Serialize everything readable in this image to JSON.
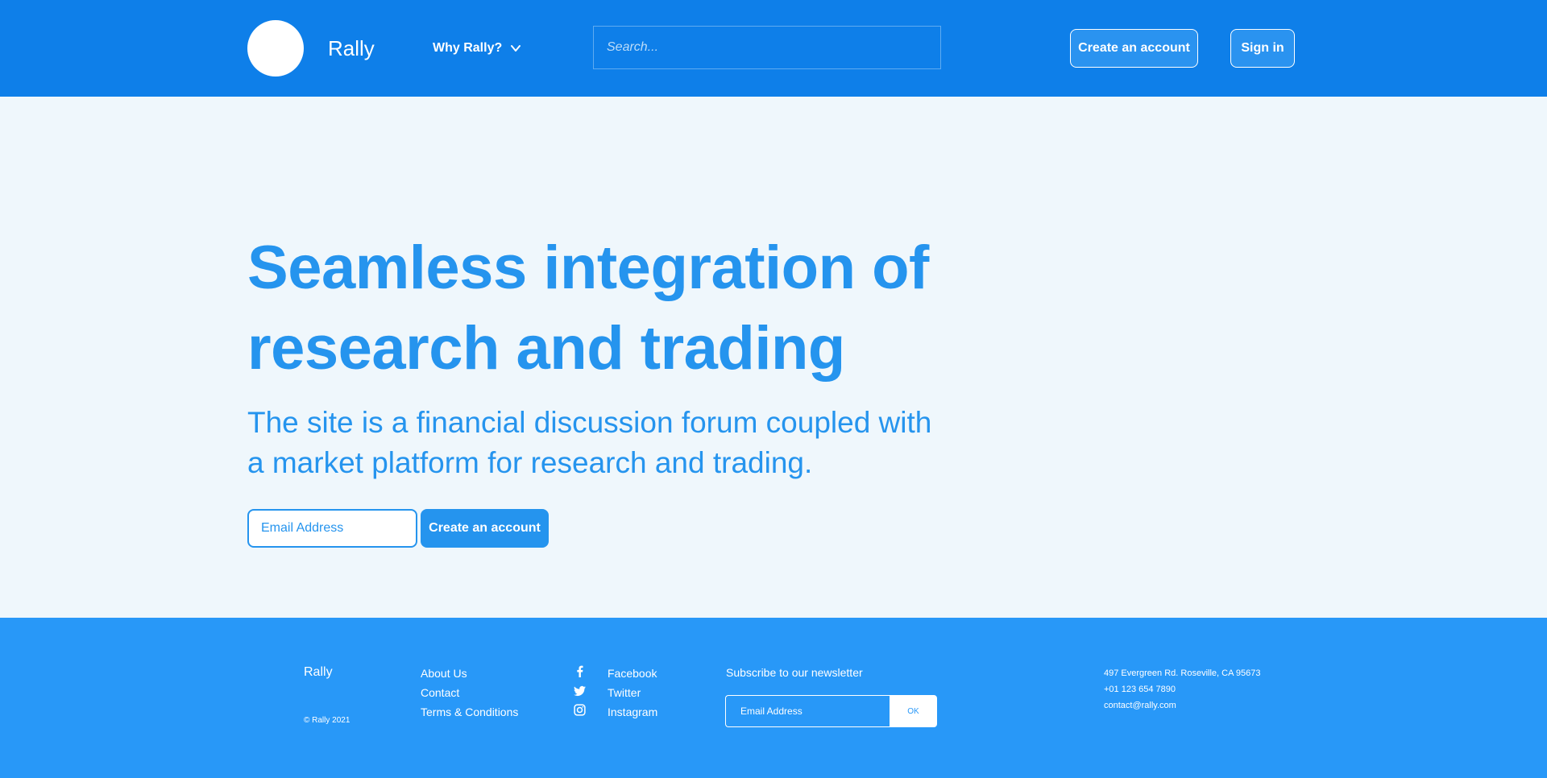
{
  "header": {
    "brand": "Rally",
    "why_label": "Why Rally?",
    "search_placeholder": "Search...",
    "create_account_label": "Create an account",
    "sign_in_label": "Sign in"
  },
  "hero": {
    "title_line1": "Seamless integration of",
    "title_line2": "research and trading",
    "subtitle_line1": "The site is a financial discussion forum coupled with",
    "subtitle_line2": "a market platform for research and trading.",
    "email_placeholder": "Email Address",
    "cta_label": "Create an account"
  },
  "footer": {
    "brand": "Rally",
    "copyright": "© Rally 2021",
    "links": [
      "About Us",
      "Contact",
      "Terms & Conditions"
    ],
    "social": [
      {
        "label": "Facebook",
        "icon": "facebook-icon"
      },
      {
        "label": "Twitter",
        "icon": "twitter-icon"
      },
      {
        "label": "Instagram",
        "icon": "instagram-icon"
      }
    ],
    "newsletter_label": "Subscribe to our newsletter",
    "newsletter_placeholder": "Email Address",
    "newsletter_button": "OK",
    "address": "497 Evergreen Rd. Roseville, CA 95673",
    "phone": "+01 123 654 7890",
    "email": "contact@rally.com"
  },
  "colors": {
    "header_bg": "#0e7fe9",
    "hero_bg": "#eff7fc",
    "accent": "#2594ee",
    "footer_bg": "#2898f8"
  }
}
